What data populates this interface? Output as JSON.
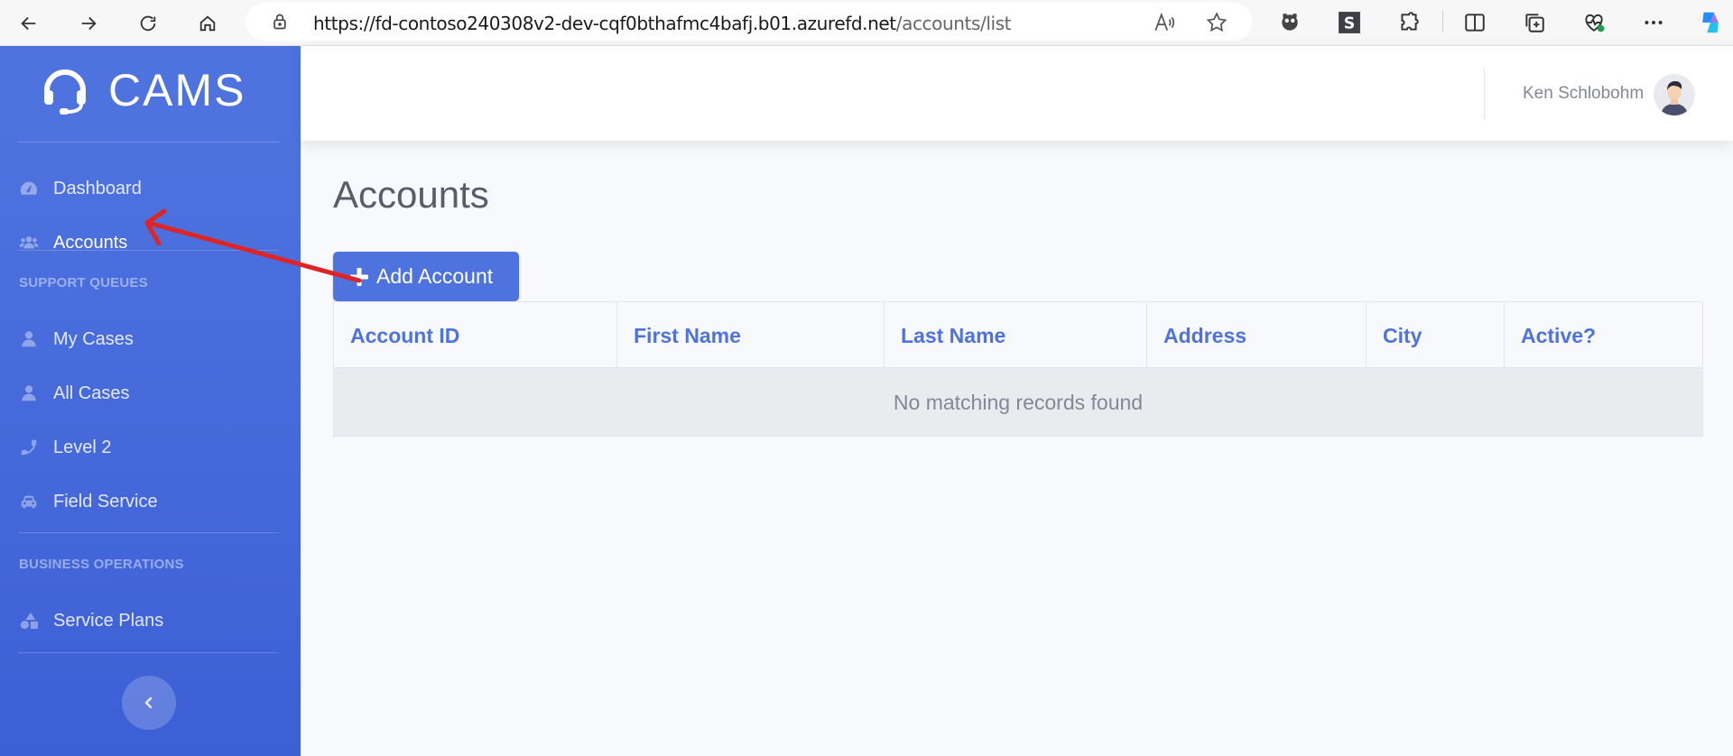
{
  "browser": {
    "url_host": "https://fd-contoso240308v2-dev-cqf0bthafmc4bafj.b01.azurefd.net",
    "url_path": "/accounts/list",
    "icons": [
      "back-icon",
      "forward-icon",
      "refresh-icon",
      "home-icon",
      "lock-icon",
      "read-aloud-icon",
      "favorite-star-icon",
      "extension-icon",
      "s-extension-icon",
      "puzzle-icon",
      "split-screen-icon",
      "collections-icon",
      "health-icon",
      "more-icon",
      "copilot-icon"
    ]
  },
  "sidebar": {
    "brand": "CAMS",
    "items": [
      {
        "label": "Dashboard",
        "icon": "dashboard-icon"
      },
      {
        "label": "Accounts",
        "icon": "users-icon"
      }
    ],
    "support_heading": "SUPPORT QUEUES",
    "support_items": [
      {
        "label": "My Cases",
        "icon": "user-icon"
      },
      {
        "label": "All Cases",
        "icon": "user-icon"
      },
      {
        "label": "Level 2",
        "icon": "phone-icon"
      },
      {
        "label": "Field Service",
        "icon": "car-icon"
      }
    ],
    "business_heading": "BUSINESS OPERATIONS",
    "business_items": [
      {
        "label": "Service Plans",
        "icon": "shapes-icon"
      }
    ],
    "colors": {
      "gradient_top": "#4e73df",
      "gradient_bottom": "#3d5fd6"
    }
  },
  "topbar": {
    "user_name": "Ken Schlobohm"
  },
  "main": {
    "title": "Accounts",
    "add_button": "Add Account",
    "table": {
      "columns": [
        "Account ID",
        "First Name",
        "Last Name",
        "Address",
        "City",
        "Active?"
      ],
      "empty_message": "No matching records found"
    }
  },
  "colors": {
    "accent": "#4e73df",
    "annotation_arrow": "#e02424"
  }
}
